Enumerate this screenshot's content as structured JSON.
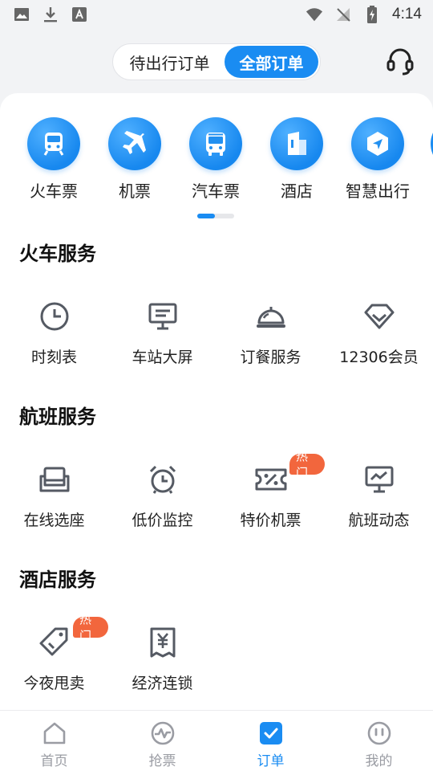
{
  "status_bar": {
    "time": "4:14"
  },
  "header": {
    "tabs": [
      {
        "label": "待出行订单",
        "active": false
      },
      {
        "label": "全部订单",
        "active": true
      }
    ],
    "customer_service_icon": "headset-icon",
    "accent": "#1a8cf2"
  },
  "top_nav": [
    {
      "label": "火车票",
      "icon": "train-icon"
    },
    {
      "label": "机票",
      "icon": "airplane-icon"
    },
    {
      "label": "汽车票",
      "icon": "bus-icon"
    },
    {
      "label": "酒店",
      "icon": "hotel-icon"
    },
    {
      "label": "智慧出行",
      "icon": "navigation-icon"
    }
  ],
  "sections": [
    {
      "title": "火车服务",
      "items": [
        {
          "label": "时刻表",
          "icon": "clock-icon"
        },
        {
          "label": "车站大屏",
          "icon": "display-screen-icon"
        },
        {
          "label": "订餐服务",
          "icon": "cloche-icon"
        },
        {
          "label": "12306会员",
          "icon": "diamond-icon"
        }
      ]
    },
    {
      "title": "航班服务",
      "items": [
        {
          "label": "在线选座",
          "icon": "seat-icon"
        },
        {
          "label": "低价监控",
          "icon": "alarm-clock-icon"
        },
        {
          "label": "特价机票",
          "icon": "discount-ticket-icon",
          "badge": "热门"
        },
        {
          "label": "航班动态",
          "icon": "trend-monitor-icon"
        }
      ]
    },
    {
      "title": "酒店服务",
      "items": [
        {
          "label": "今夜甩卖",
          "icon": "price-tag-icon",
          "badge": "热门"
        },
        {
          "label": "经济连锁",
          "icon": "yuan-receipt-icon"
        }
      ]
    }
  ],
  "bottom_nav": [
    {
      "label": "首页",
      "icon": "home-icon",
      "active": false
    },
    {
      "label": "抢票",
      "icon": "pulse-icon",
      "active": false
    },
    {
      "label": "订单",
      "icon": "order-check-icon",
      "active": true
    },
    {
      "label": "我的",
      "icon": "profile-icon",
      "active": false
    }
  ],
  "colors": {
    "badge": "#f2663d",
    "inactive": "#9a9ca3",
    "icon_stroke": "#555a63"
  }
}
